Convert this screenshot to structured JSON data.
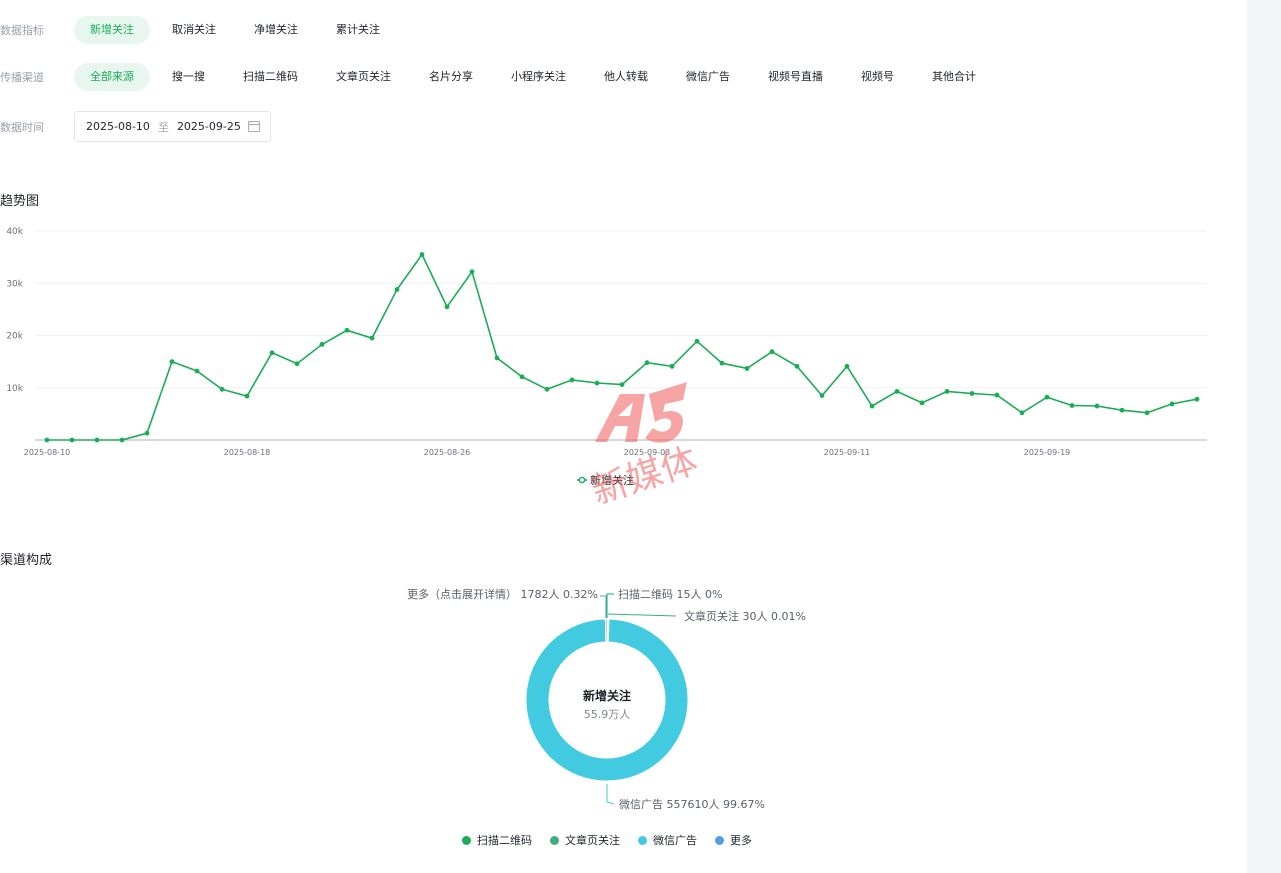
{
  "filters": {
    "metric": {
      "label": "数据指标",
      "options": [
        "新增关注",
        "取消关注",
        "净增关注",
        "累计关注"
      ],
      "active_index": 0
    },
    "channel": {
      "label": "传播渠道",
      "options": [
        "全部来源",
        "搜一搜",
        "扫描二维码",
        "文章页关注",
        "名片分享",
        "小程序关注",
        "他人转载",
        "微信广告",
        "视频号直播",
        "视频号",
        "其他合计"
      ],
      "active_index": 0
    },
    "time": {
      "label": "数据时间",
      "start": "2025-08-10",
      "separator": "至",
      "end": "2025-09-25"
    }
  },
  "trend": {
    "title": "趋势图",
    "legend": "新增关注",
    "color": "#1aad55"
  },
  "chart_data": {
    "type": "line",
    "y_ticks": [
      "40k",
      "30k",
      "20k",
      "10k"
    ],
    "x_tick_labels": [
      "2025-08-10",
      "2025-08-18",
      "2025-08-26",
      "2025-09-03",
      "2025-09-11",
      "2025-09-19"
    ],
    "ylim": [
      0,
      40000
    ],
    "x_start": "2025-08-10",
    "series": [
      {
        "name": "新增关注",
        "values": [
          0,
          0,
          0,
          0,
          1300,
          15000,
          13200,
          9700,
          8400,
          16700,
          14600,
          18300,
          21000,
          19500,
          28800,
          35500,
          25500,
          32200,
          15700,
          12100,
          9700,
          11500,
          10900,
          10600,
          14800,
          14100,
          18900,
          14700,
          13700,
          16900,
          14100,
          8500,
          14100,
          6500,
          9300,
          7100,
          9300,
          8900,
          8600,
          5200,
          8200,
          6600,
          6500,
          5700,
          5200,
          6900,
          7800
        ]
      }
    ]
  },
  "composition": {
    "title": "渠道构成",
    "center_title": "新增关注",
    "center_value": "55.9万人",
    "labels": {
      "more": "更多（点击展开详情） 1782人 0.32%",
      "qr": "扫描二维码 15人 0%",
      "article": "文章页关注 30人 0.01%",
      "ads": "微信广告 557610人 99.67%"
    },
    "slices": [
      {
        "name": "扫描二维码",
        "value": 15,
        "color": "#1aad55"
      },
      {
        "name": "文章页关注",
        "value": 30,
        "color": "#3dae7a"
      },
      {
        "name": "微信广告",
        "value": 557610,
        "color": "#42cbe0"
      },
      {
        "name": "更多",
        "value": 1782,
        "color": "#4f9fe0"
      }
    ],
    "legend": [
      {
        "label": "扫描二维码",
        "color": "#1aad55"
      },
      {
        "label": "文章页关注",
        "color": "#3dae7a"
      },
      {
        "label": "微信广告",
        "color": "#42cbe0"
      },
      {
        "label": "更多",
        "color": "#4f9fe0"
      }
    ]
  },
  "watermark": {
    "text": "新媒体",
    "color": "#f25b5b"
  }
}
